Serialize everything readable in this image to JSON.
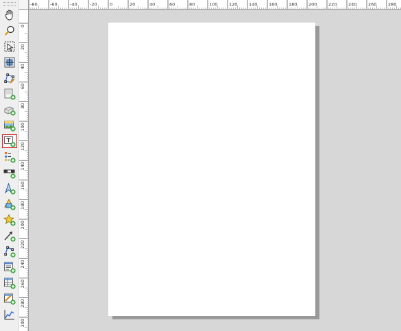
{
  "toolbar": {
    "tools": [
      {
        "name": "pan-tool",
        "icon": "hand-icon",
        "active": false
      },
      {
        "name": "zoom-tool",
        "icon": "magnifier-icon",
        "active": false
      },
      {
        "name": "select-move-tool",
        "icon": "select-arrow-icon",
        "active": false
      },
      {
        "name": "move-item-content-tool",
        "icon": "move-content-icon",
        "active": false
      },
      {
        "name": "edit-nodes-tool",
        "icon": "edit-nodes-icon",
        "active": false
      },
      {
        "name": "add-map-tool",
        "icon": "add-map-icon",
        "active": false
      },
      {
        "name": "add-3d-map-tool",
        "icon": "add-3d-map-icon",
        "active": false
      },
      {
        "name": "add-picture-tool",
        "icon": "add-picture-icon",
        "active": false
      },
      {
        "name": "add-label-tool",
        "icon": "add-label-icon",
        "active": true
      },
      {
        "name": "add-legend-tool",
        "icon": "add-legend-icon",
        "active": false
      },
      {
        "name": "add-scalebar-tool",
        "icon": "add-scalebar-icon",
        "active": false
      },
      {
        "name": "add-north-arrow-tool",
        "icon": "add-north-arrow-icon",
        "active": false
      },
      {
        "name": "add-shape-tool",
        "icon": "add-shape-icon",
        "active": false
      },
      {
        "name": "add-marker-tool",
        "icon": "add-marker-icon",
        "active": false
      },
      {
        "name": "add-arrow-tool",
        "icon": "add-arrow-icon",
        "active": false
      },
      {
        "name": "add-node-item-tool",
        "icon": "add-node-item-icon",
        "active": false
      },
      {
        "name": "add-html-tool",
        "icon": "add-html-icon",
        "active": false
      },
      {
        "name": "add-attribute-table-tool",
        "icon": "add-attribute-table-icon",
        "active": false
      },
      {
        "name": "add-fixed-table-tool",
        "icon": "add-fixed-table-icon",
        "active": false
      },
      {
        "name": "add-elevation-profile-tool",
        "icon": "add-elevation-profile-icon",
        "active": false
      }
    ]
  },
  "rulers": {
    "horizontal_labels": [
      "-80",
      "-60",
      "-40",
      "-20",
      "0",
      "20",
      "40",
      "60",
      "80",
      "100",
      "120",
      "140",
      "160",
      "180",
      "200",
      "220",
      "240",
      "260",
      "280"
    ],
    "vertical_labels": [
      "0",
      "20",
      "40",
      "60",
      "80",
      "100",
      "120",
      "140",
      "160",
      "180",
      "200",
      "220",
      "240",
      "260",
      "280",
      "300"
    ]
  },
  "colors": {
    "canvas_background": "#d7d7d7",
    "page": "#ffffff",
    "page_shadow": "#999999",
    "active_tool_border": "#d32020"
  }
}
